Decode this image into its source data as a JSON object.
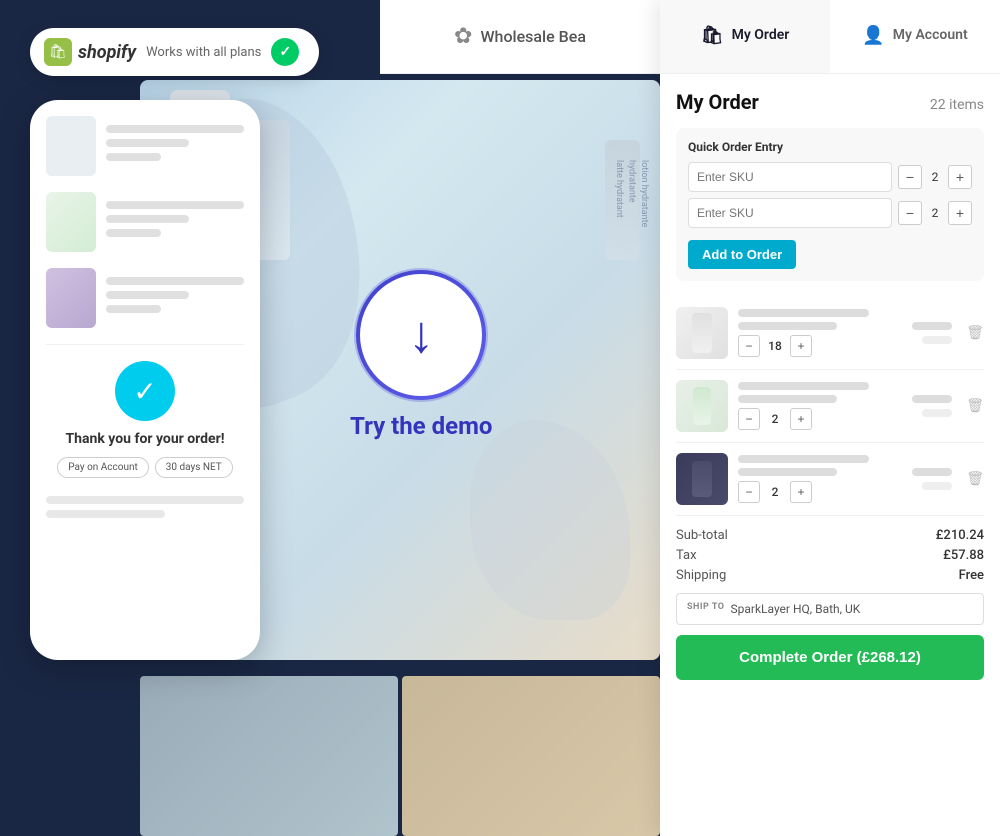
{
  "shopify_badge": {
    "logo_text": "shopify",
    "plans_text": "Works with all plans"
  },
  "wholesale_header": {
    "name": "Wholesale Bea"
  },
  "demo": {
    "text": "Try the demo"
  },
  "phone": {
    "thankyou_title": "Thank you for your order!",
    "badge1": "Pay on Account",
    "badge2": "30 days NET"
  },
  "panel": {
    "tab_order": "My Order",
    "tab_account": "My Account",
    "order_title": "My Order",
    "order_count": "22 items",
    "quick_order": {
      "title": "Quick Order Entry",
      "sku_placeholder": "Enter SKU",
      "qty1": "2",
      "qty2": "2",
      "add_button": "Add to Order"
    },
    "products": [
      {
        "qty": "18"
      },
      {
        "qty": "2"
      },
      {
        "qty": "2"
      }
    ],
    "summary": {
      "subtotal_label": "Sub-total",
      "subtotal_value": "£210.24",
      "tax_label": "Tax",
      "tax_value": "£57.88",
      "shipping_label": "Shipping",
      "shipping_value": "Free"
    },
    "ship_to_label": "SHIP TO",
    "ship_to_address": "SparkLayer HQ, Bath, UK",
    "complete_button": "Complete Order (£268.12)"
  }
}
